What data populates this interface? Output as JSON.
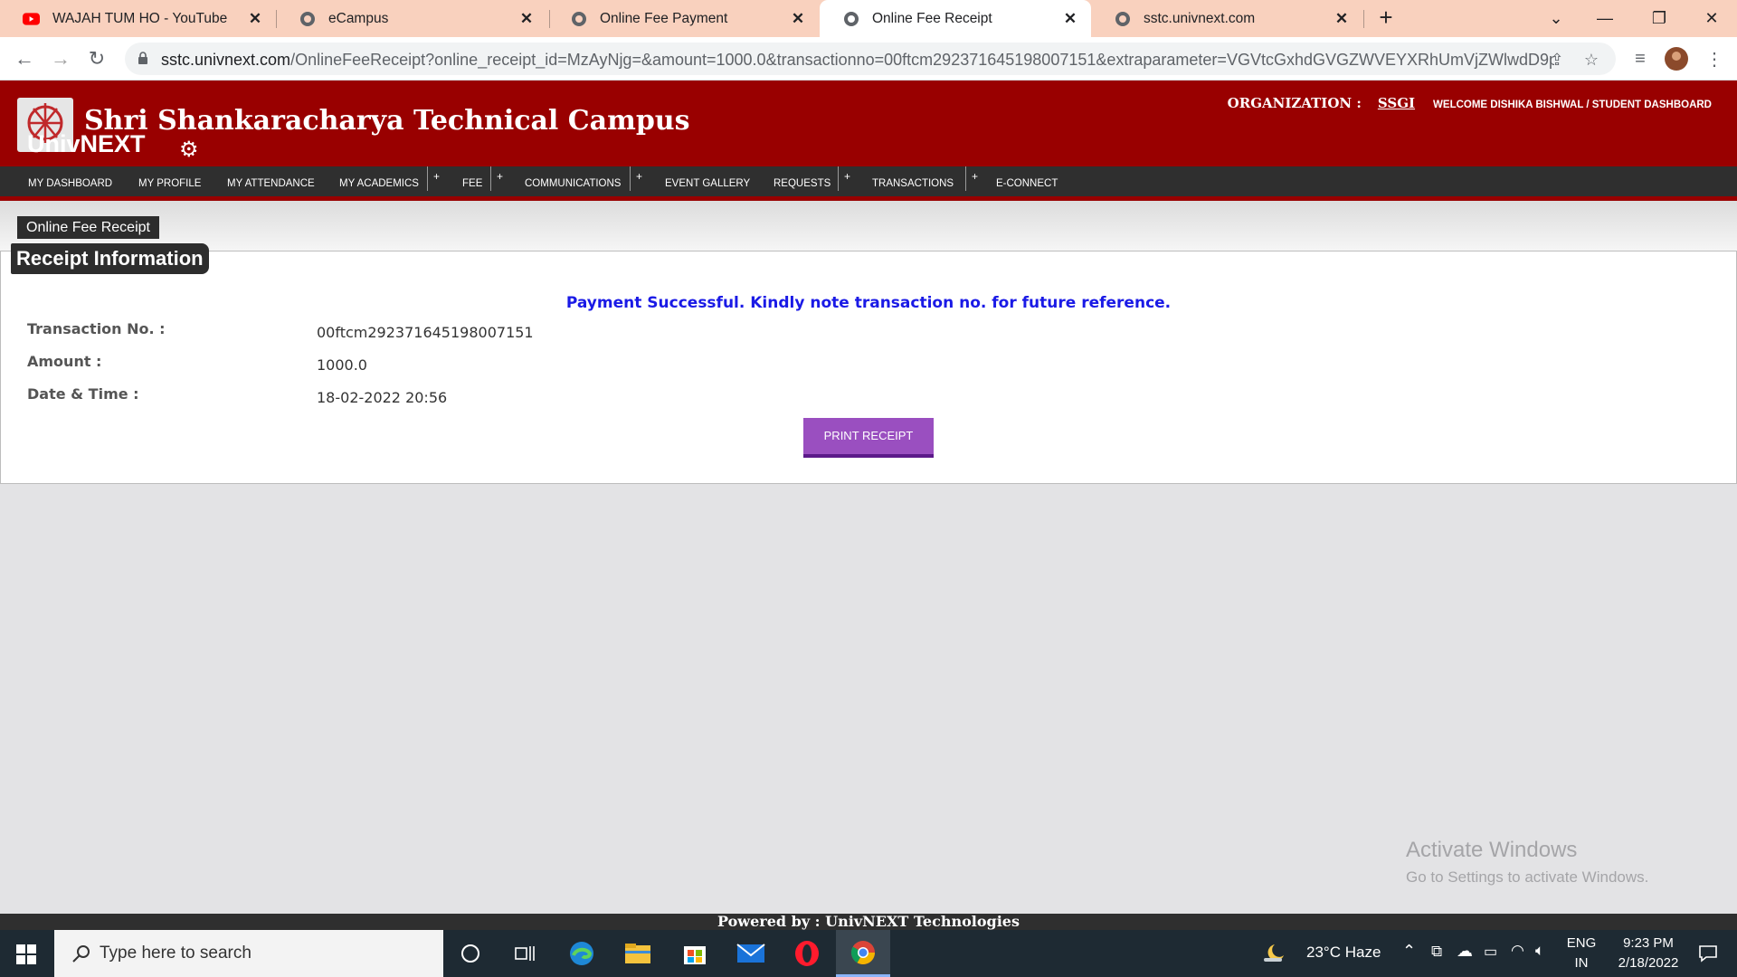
{
  "browser": {
    "tabs": [
      {
        "title": "WAJAH TUM HO - YouTube",
        "favicon": "youtube-icon",
        "active": false
      },
      {
        "title": "eCampus",
        "favicon": "globe-icon",
        "active": false
      },
      {
        "title": "Online Fee Payment",
        "favicon": "globe-icon",
        "active": false
      },
      {
        "title": "Online Fee Receipt",
        "favicon": "globe-icon",
        "active": true
      },
      {
        "title": "sstc.univnext.com",
        "favicon": "globe-icon",
        "active": false
      }
    ],
    "url_host": "sstc.univnext.com",
    "url_path": "/OnlineFeeReceipt?online_receipt_id=MzAyNjg=&amount=1000.0&transactionno=00ftcm292371645198007151&extraparameter=VGVtcGxhdGVGZWVEYXRhUmVjZWlwdD9pZD..."
  },
  "header": {
    "institute_name": "Shri Shankaracharya Technical Campus",
    "brand": "UnivNEXT",
    "org_label": "ORGANIZATION :",
    "org_value": "SSGI",
    "welcome": "WELCOME DISHIKA BISHWAL / STUDENT DASHBOARD"
  },
  "menu": [
    {
      "label": "MY DASHBOARD",
      "has_sub": false
    },
    {
      "label": "MY PROFILE",
      "has_sub": false
    },
    {
      "label": "MY ATTENDANCE",
      "has_sub": false
    },
    {
      "label": "MY ACADEMICS",
      "has_sub": true
    },
    {
      "label": "FEE",
      "has_sub": true
    },
    {
      "label": "COMMUNICATIONS",
      "has_sub": true
    },
    {
      "label": "EVENT GALLERY",
      "has_sub": false
    },
    {
      "label": "REQUESTS",
      "has_sub": true
    },
    {
      "label": "TRANSACTIONS",
      "has_sub": true
    },
    {
      "label": "E-CONNECT",
      "has_sub": false
    }
  ],
  "menu_plus": "+",
  "page": {
    "breadcrumb": "Online Fee Receipt",
    "section_title": "Receipt Information",
    "success_message": "Payment Successful. Kindly note transaction no. for future reference.",
    "fields": [
      {
        "label": "Transaction No. :",
        "value": "00ftcm292371645198007151"
      },
      {
        "label": "Amount :",
        "value": "1000.0"
      },
      {
        "label": "Date & Time :",
        "value": "18-02-2022 20:56"
      }
    ],
    "print_button": "PRINT RECEIPT"
  },
  "watermark": {
    "line1": "Activate Windows",
    "line2": "Go to Settings to activate Windows."
  },
  "footer": "Powered by : UnivNEXT Technologies",
  "taskbar": {
    "search_placeholder": "Type here to search",
    "weather": "23°C  Haze",
    "lang_top": "ENG",
    "lang_bottom": "IN",
    "time": "9:23 PM",
    "date": "2/18/2022"
  },
  "colors": {
    "header_red": "#990000",
    "menu_dark": "#2f2f2f",
    "print_button": "#9a4fc0",
    "success_blue": "#1a1ae6",
    "tabstrip": "#f9d1be"
  }
}
